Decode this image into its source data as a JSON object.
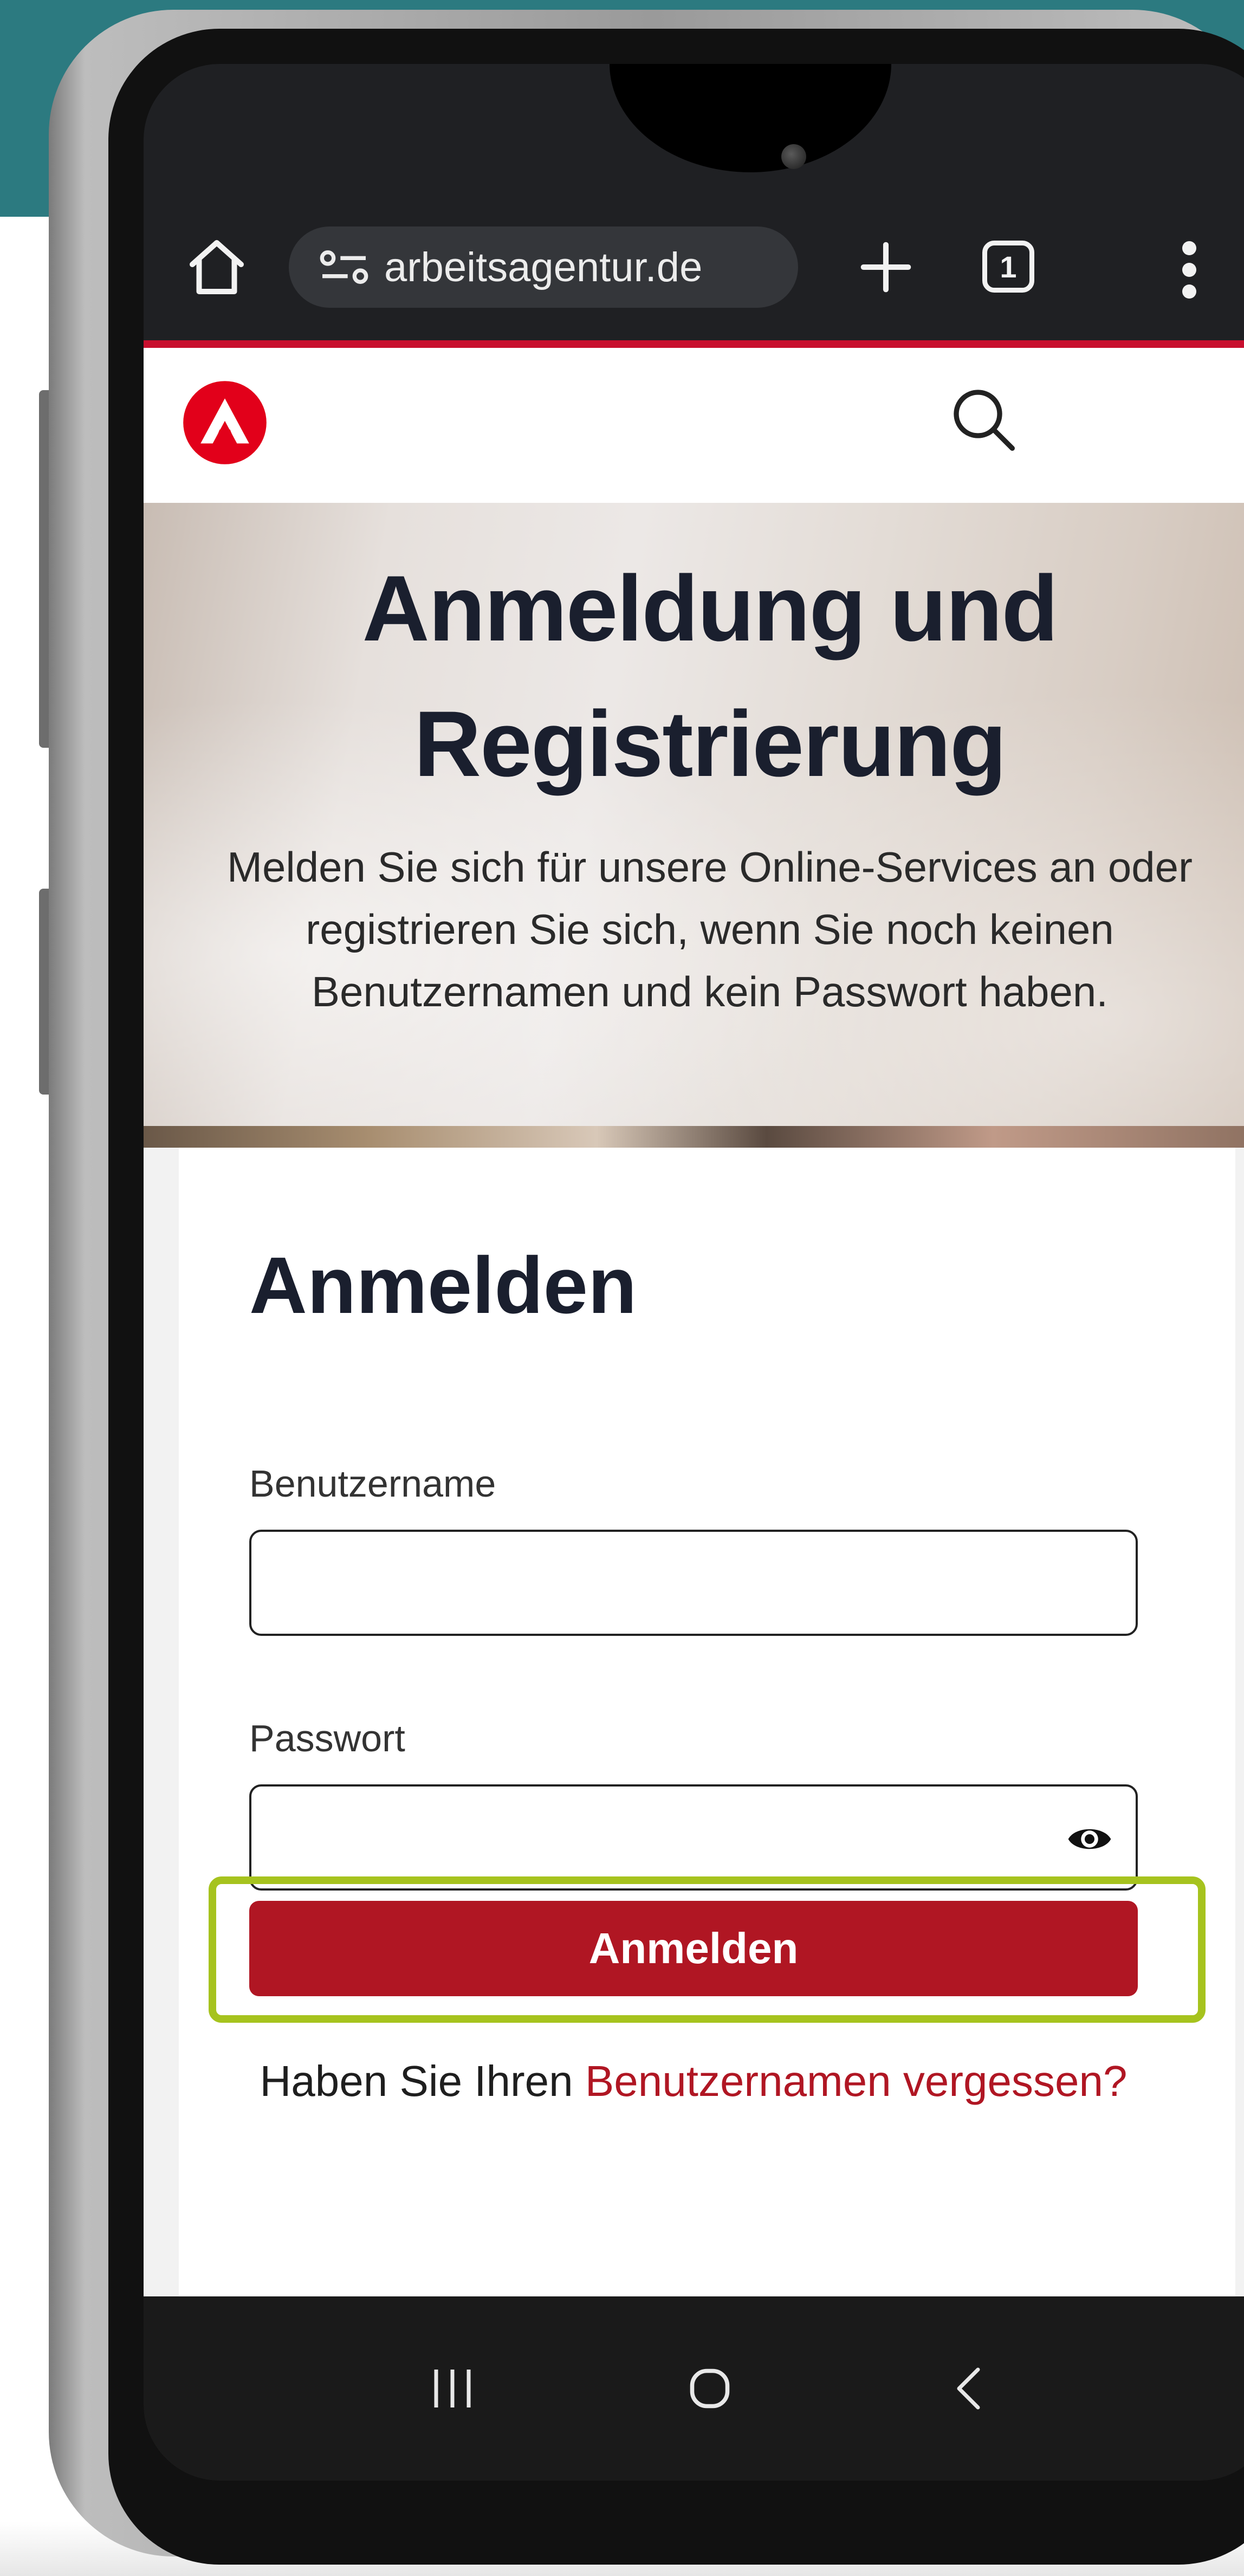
{
  "browser": {
    "url": "arbeitsagentur.de",
    "tab_count": "1"
  },
  "hero": {
    "title_line1": "Anmeldung und",
    "title_line2": "Registrierung",
    "description": "Melden Sie sich für unsere Online-Services an oder registrieren Sie sich, wenn Sie noch keinen Benutzernamen und kein Passwort haben."
  },
  "login": {
    "title": "Anmelden",
    "username_label": "Benutzername",
    "username_value": "",
    "password_label": "Passwort",
    "password_value": "",
    "submit_label": "Anmelden",
    "forgot_prefix": "Haben Sie Ihren ",
    "forgot_link": "Benutzernamen vergessen?"
  },
  "icons": {
    "home": "home-icon",
    "site_info": "tune-icon",
    "new_tab": "plus-icon",
    "tabs": "tab-switcher-icon",
    "menu": "more-vert-icon",
    "logo": "bundesagentur-logo",
    "search": "search-icon",
    "password_toggle": "eye-icon",
    "recents": "recents-icon",
    "system_home": "home-circle-icon",
    "back": "back-icon"
  },
  "colors": {
    "accent_red": "#b01623",
    "highlight_green": "#a6c31e",
    "browser_bar": "#1f2023",
    "teal_background": "#2c7a80"
  }
}
